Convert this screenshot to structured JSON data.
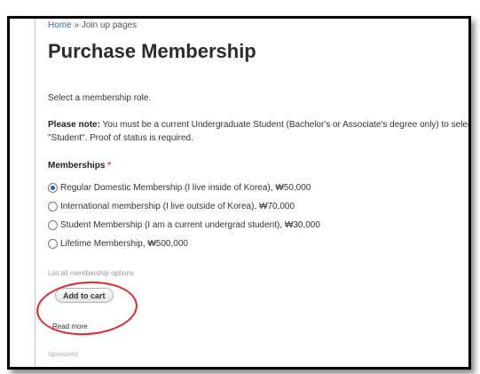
{
  "breadcrumb": {
    "home": "Home",
    "separator": " » ",
    "current": "Join up pages"
  },
  "page_title": "Purchase Membership",
  "intro_text": "Select a membership role.",
  "note": {
    "label": "Please note:",
    "text": " You must be a current Undergraduate Student (Bachelor's or Associate's degree only) to select \"Student\".  Proof of status is required."
  },
  "memberships": {
    "label": "Memberships",
    "required_marker": "*",
    "selected_index": 0,
    "options": [
      {
        "label": "Regular Domestic Membership (I live inside of Korea), ₩50,000"
      },
      {
        "label": "International membership (I live outside of Korea), ₩70,000"
      },
      {
        "label": "Student Membership (I am a current undergrad student), ₩30,000"
      },
      {
        "label": "Lifetime Membership, ₩500,000"
      }
    ],
    "list_link": "List all membership options"
  },
  "add_to_cart_label": "Add to cart",
  "read_more": "Read more",
  "sponsored": "Sponsored",
  "colors": {
    "link": "#2a6db5",
    "required": "#e03a3a",
    "highlight_circle": "#e2262b"
  }
}
